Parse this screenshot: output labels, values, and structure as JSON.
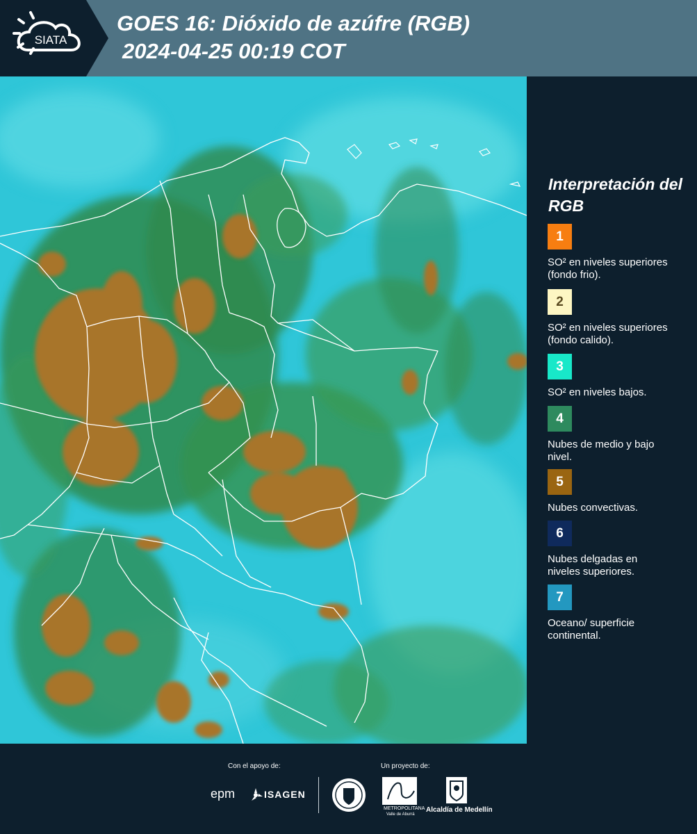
{
  "header": {
    "logo_text": "SIATA",
    "title_line1": "GOES 16: Dióxido de azúfre (RGB)",
    "title_line2": " 2024-04-25 00:19 COT"
  },
  "legend": {
    "title": "Interpretación del RGB",
    "items": [
      {
        "number": "1",
        "color": "#f77e11",
        "text": "SO² en niveles superiores (fondo frio)."
      },
      {
        "number": "2",
        "color": "#fdf6c3",
        "text": "SO² en niveles superiores (fondo calido)."
      },
      {
        "number": "3",
        "color": "#18e8c9",
        "text": "SO² en niveles bajos."
      },
      {
        "number": "4",
        "color": "#2e8a5e",
        "text": "Nubes de medio y bajo nivel."
      },
      {
        "number": "5",
        "color": "#9a6511",
        "text": "Nubes convectivas."
      },
      {
        "number": "6",
        "color": "#0f2a5c",
        "text": "Nubes delgadas en niveles superiores."
      },
      {
        "number": "7",
        "color": "#2398c0",
        "text": "Oceano/ superficie continental."
      }
    ]
  },
  "footer": {
    "support_label": "Con el apoyo de:",
    "project_label": "Un proyecto de:",
    "sponsor_epm": "epm",
    "sponsor_isagen": "ISAGEN",
    "partner_area_line1": "METROPOLITANA",
    "partner_area_line2": "Valle de Aburrá",
    "partner_alcaldia": "Alcaldía de Medellín"
  },
  "colors": {
    "header_bg": "#4f7384",
    "panel_bg": "#0d1f2d",
    "map_base": "#2fc6d8",
    "cloud_green": "#2f8a4e",
    "cloud_convective": "#a8752a"
  }
}
